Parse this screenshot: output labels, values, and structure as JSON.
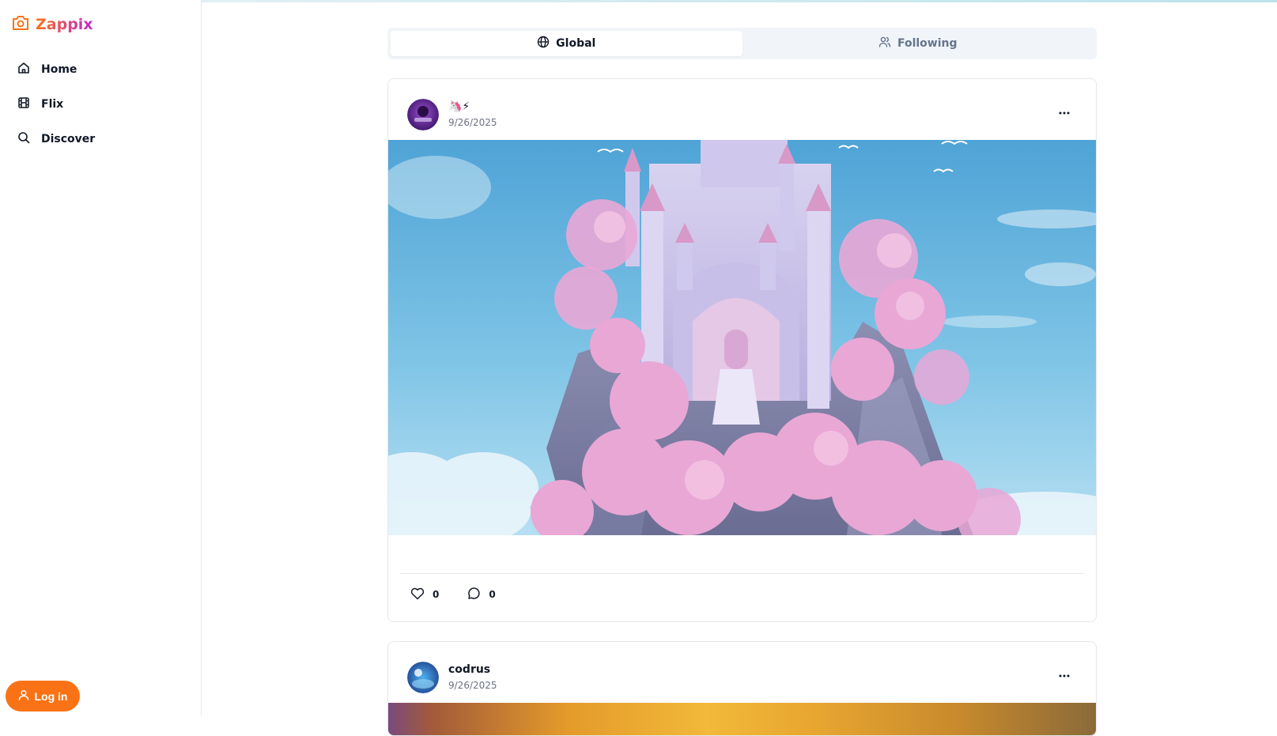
{
  "brand": {
    "name": "Zappix",
    "icon": "camera-icon"
  },
  "sidebar": {
    "items": [
      {
        "label": "Home",
        "icon": "home-icon"
      },
      {
        "label": "Flix",
        "icon": "film-icon"
      },
      {
        "label": "Discover",
        "icon": "search-icon"
      }
    ],
    "login_label": "Log in"
  },
  "feed": {
    "tabs": [
      {
        "label": "Global",
        "icon": "globe-icon",
        "active": true
      },
      {
        "label": "Following",
        "icon": "users-icon",
        "active": false
      }
    ]
  },
  "posts": [
    {
      "author": "🦄⚡",
      "date": "9/26/2025",
      "likes": "0",
      "comments": "0"
    },
    {
      "author": "codrus",
      "date": "9/26/2025"
    }
  ],
  "colors": {
    "accent": "#f97316",
    "brand_end": "#c026d3"
  }
}
